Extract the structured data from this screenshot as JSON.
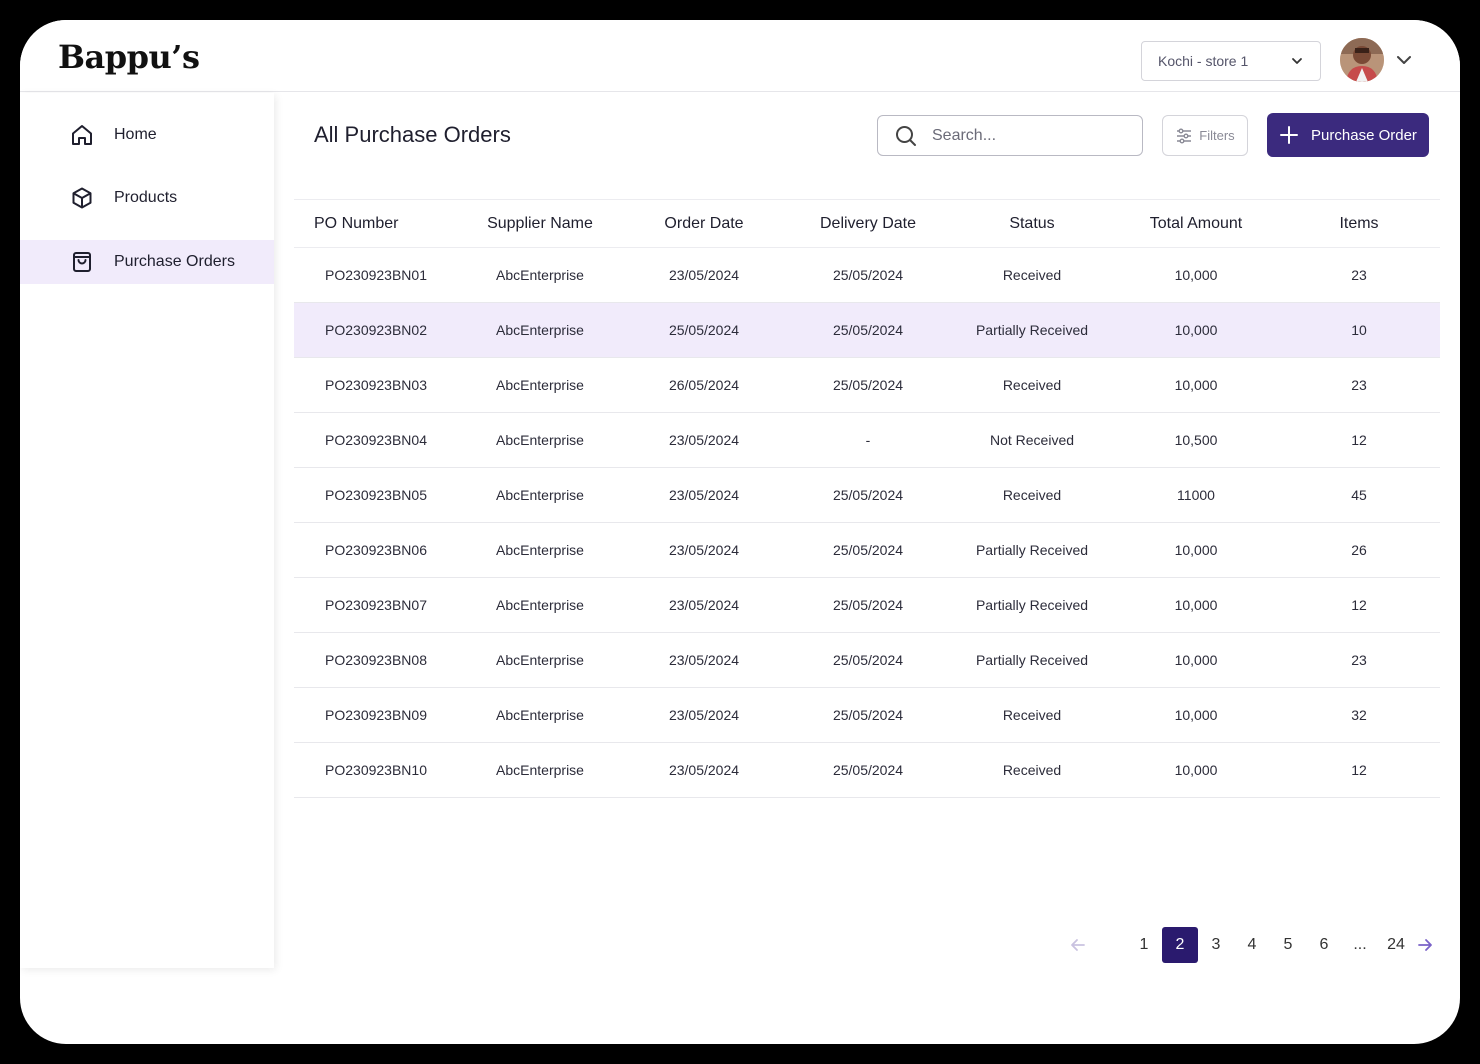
{
  "header": {
    "logo": "Bappu’s",
    "store_select": "Kochi - store 1"
  },
  "sidebar": {
    "items": [
      {
        "label": "Home",
        "icon": "home-icon",
        "active": false
      },
      {
        "label": "Products",
        "icon": "box-icon",
        "active": false
      },
      {
        "label": "Purchase Orders",
        "icon": "shopping-bag-icon",
        "active": true
      }
    ]
  },
  "main": {
    "title": "All Purchase Orders",
    "search_placeholder": "Search...",
    "filters_label": "Filters",
    "new_button_label": "Purchase Order"
  },
  "table": {
    "columns": [
      "PO Number",
      "Supplier Name",
      "Order Date",
      "Delivery Date",
      "Status",
      "Total Amount",
      "Items"
    ],
    "selected_row": 1,
    "rows": [
      [
        "PO230923BN01",
        "AbcEnterprise",
        "23/05/2024",
        "25/05/2024",
        "Received",
        "10,000",
        "23"
      ],
      [
        "PO230923BN02",
        "AbcEnterprise",
        "25/05/2024",
        "25/05/2024",
        "Partially Received",
        "10,000",
        "10"
      ],
      [
        "PO230923BN03",
        "AbcEnterprise",
        "26/05/2024",
        "25/05/2024",
        "Received",
        "10,000",
        "23"
      ],
      [
        "PO230923BN04",
        "AbcEnterprise",
        "23/05/2024",
        "-",
        "Not Received",
        "10,500",
        "12"
      ],
      [
        "PO230923BN05",
        "AbcEnterprise",
        "23/05/2024",
        "25/05/2024",
        "Received",
        "11000",
        "45"
      ],
      [
        "PO230923BN06",
        "AbcEnterprise",
        "23/05/2024",
        "25/05/2024",
        "Partially Received",
        "10,000",
        "26"
      ],
      [
        "PO230923BN07",
        "AbcEnterprise",
        "23/05/2024",
        "25/05/2024",
        "Partially Received",
        "10,000",
        "12"
      ],
      [
        "PO230923BN08",
        "AbcEnterprise",
        "23/05/2024",
        "25/05/2024",
        "Partially Received",
        "10,000",
        "23"
      ],
      [
        "PO230923BN09",
        "AbcEnterprise",
        "23/05/2024",
        "25/05/2024",
        "Received",
        "10,000",
        "32"
      ],
      [
        "PO230923BN10",
        "AbcEnterprise",
        "23/05/2024",
        "25/05/2024",
        "Received",
        "10,000",
        "12"
      ]
    ]
  },
  "pagination": {
    "pages": [
      "1",
      "2",
      "3",
      "4",
      "5",
      "6",
      "...",
      "24"
    ],
    "current": "2"
  },
  "colors": {
    "accent": "#3b2a7e",
    "active_page": "#2a1a6e",
    "selected_row": "#f1ebfb",
    "frame": "#000000"
  }
}
